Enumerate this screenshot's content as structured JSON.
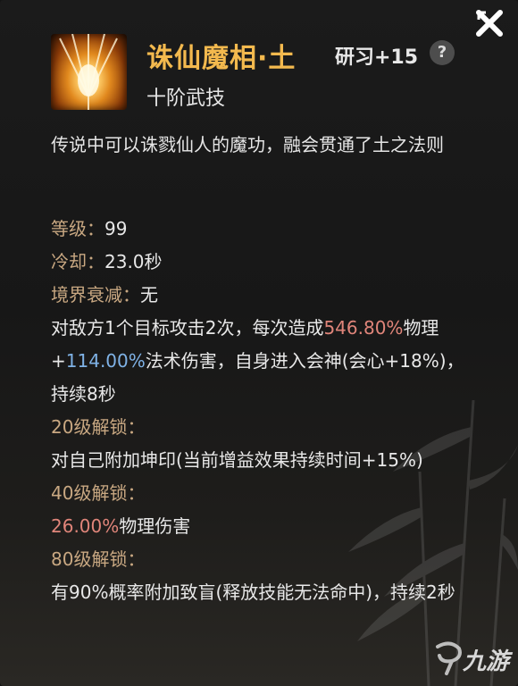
{
  "skill": {
    "name": "诛仙魔相·土",
    "study_level": "研习+15",
    "rank": "十阶武技",
    "description": "传说中可以诛戮仙人的魔功，融会贯通了土之法则",
    "help_icon": "?"
  },
  "stats": {
    "level_label": "等级：",
    "level_value": "99",
    "cooldown_label": "冷却：",
    "cooldown_value": "23.0秒",
    "decay_label": "境界衰减：",
    "decay_value": "无"
  },
  "effect": {
    "part1": "对敌方1个目标攻击2次，每次造成",
    "physical_pct": "546.80%",
    "part2": "物理+",
    "magic_pct": "114.00%",
    "part3": "法术伤害，自身进入会神(会心+18%)，持续8秒"
  },
  "unlocks": [
    {
      "label": "20级解锁：",
      "text": "对自己附加坤印(当前增益效果持续时间+15%)"
    },
    {
      "label": "40级解锁：",
      "highlight": "26.00%",
      "text": "物理伤害"
    },
    {
      "label": "80级解锁：",
      "text": "有90%概率附加致盲(释放技能无法命中)，持续2秒"
    }
  ],
  "watermark": {
    "text": "九游"
  },
  "icons": {
    "close": "close-icon",
    "help": "help-icon",
    "skill": "skill-icon",
    "watermark": "nine-game-logo-icon"
  },
  "colors": {
    "title": "#f3b94e",
    "label": "#c9a882",
    "damage_physical": "#e0857a",
    "damage_magic": "#7fb2e6"
  }
}
